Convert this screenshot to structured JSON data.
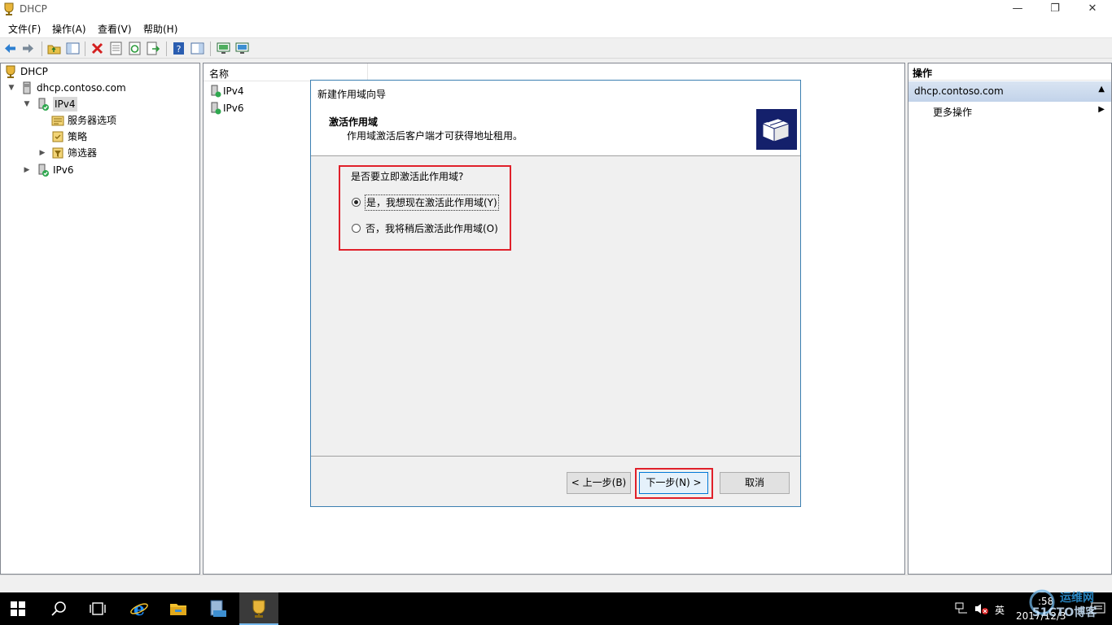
{
  "window": {
    "title": "DHCP",
    "min_glyph": "—",
    "max_glyph": "❐",
    "close_glyph": "✕"
  },
  "menu": [
    "文件(F)",
    "操作(A)",
    "查看(V)",
    "帮助(H)"
  ],
  "tree": {
    "root": "DHCP",
    "server": "dhcp.contoso.com",
    "ipv4": "IPv4",
    "server_options": "服务器选项",
    "policies": "策略",
    "filters": "筛选器",
    "ipv6": "IPv6"
  },
  "list": {
    "column_name": "名称",
    "rows": [
      "IPv4",
      "IPv6"
    ]
  },
  "actions": {
    "header": "操作",
    "section": "dhcp.contoso.com",
    "more": "更多操作"
  },
  "dialog": {
    "title": "新建作用域向导",
    "heading": "激活作用域",
    "subheading": "作用域激活后客户端才可获得地址租用。",
    "question": "是否要立即激活此作用域?",
    "option_yes": "是，我想现在激活此作用域(Y)",
    "option_no": "否，我将稍后激活此作用域(O)",
    "selected": "yes",
    "back": "< 上一步(B)",
    "next": "下一步(N) >",
    "cancel": "取消"
  },
  "taskbar": {
    "ime": "英",
    "clock_time": ":58",
    "clock_date": "2017/12/3"
  },
  "watermark": {
    "line1": "运维网",
    "line2": "51CTO博客"
  },
  "colors": {
    "highlight_box": "#e0202a",
    "selected_node": "#d9d9d9",
    "taskbar": "#000000"
  }
}
